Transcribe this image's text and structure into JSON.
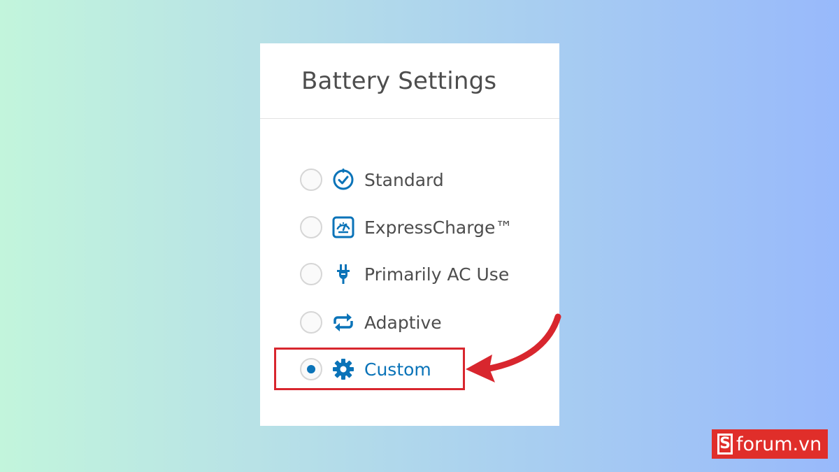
{
  "panel": {
    "title": "Battery Settings",
    "options": [
      {
        "label": "Standard",
        "icon": "clock-check-icon",
        "selected": false
      },
      {
        "label": "ExpressCharge™",
        "icon": "gauge-icon",
        "selected": false
      },
      {
        "label": "Primarily AC Use",
        "icon": "plug-icon",
        "selected": false
      },
      {
        "label": "Adaptive",
        "icon": "refresh-arrows-icon",
        "selected": false
      },
      {
        "label": "Custom",
        "icon": "gear-icon",
        "selected": true
      }
    ]
  },
  "annotation": {
    "highlight_color": "#d8262e",
    "arrow_color": "#d8262e"
  },
  "watermark": {
    "logo_letter": "S",
    "text": "forum.vn"
  },
  "colors": {
    "accent": "#0a73b8",
    "text": "#4d4d4d"
  }
}
